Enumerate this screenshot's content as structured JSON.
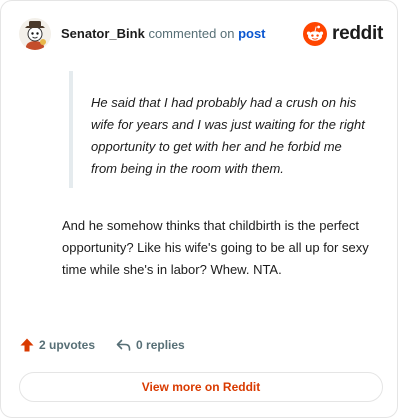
{
  "header": {
    "username": "Senator_Bink",
    "action_text": "commented on",
    "post_link_label": "post",
    "brand_word": "reddit",
    "brand_color": "#ff4500"
  },
  "comment": {
    "quote": "He said that I had probably had a crush on his wife for years and I was just waiting for the right opportunity to get with her and he forbid me from being in the room with them.",
    "body": "And he somehow thinks that childbirth is the perfect opportunity? Like his wife's going to be all up for sexy time while she's in labor? Whew. NTA."
  },
  "stats": {
    "upvotes_label": "2 upvotes",
    "upvote_icon": "upvote-arrow-icon",
    "replies_label": "0 replies",
    "reply_icon": "reply-icon"
  },
  "footer": {
    "view_more_label": "View more on Reddit"
  }
}
